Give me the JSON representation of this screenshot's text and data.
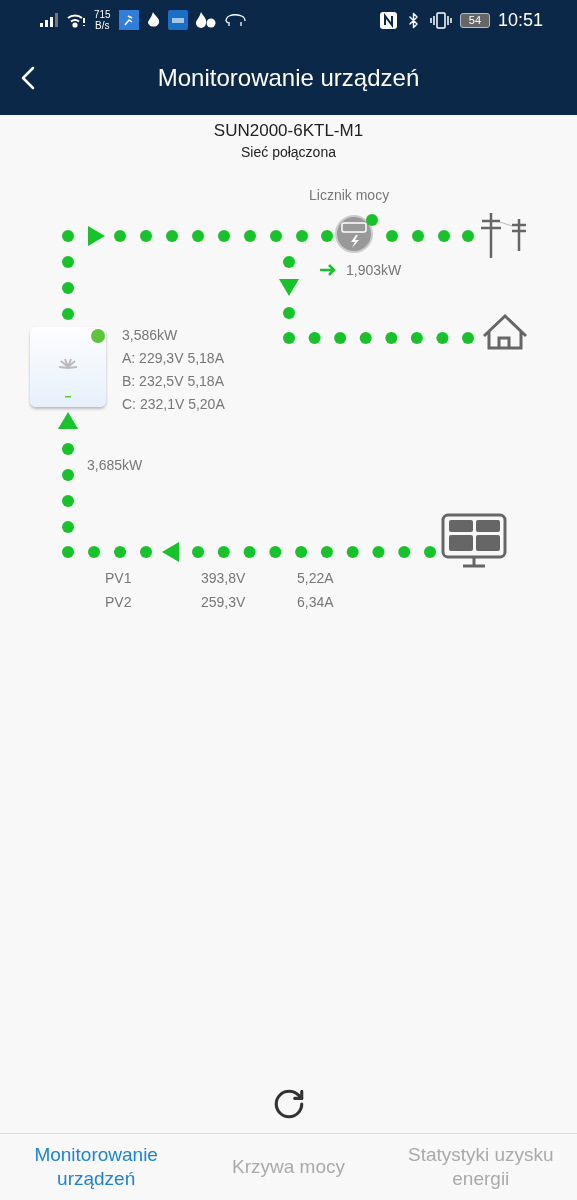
{
  "status_bar": {
    "network_speed": "715",
    "network_speed_unit": "B/s",
    "battery": "54",
    "time": "10:51"
  },
  "header": {
    "title": "Monitorowanie urządzeń"
  },
  "device": {
    "name": "SUN2000-6KTL-M1",
    "status": "Sieć połączona"
  },
  "meter": {
    "label": "Licznik mocy",
    "power": "1,903kW"
  },
  "inverter": {
    "power": "3,586kW",
    "phases": [
      "A: 229,3V 5,18A",
      "B: 232,5V 5,18A",
      "C: 232,1V 5,20A"
    ]
  },
  "pv": {
    "power": "3,685kW",
    "strings": [
      {
        "name": "PV1",
        "voltage": "393,8V",
        "current": "5,22A"
      },
      {
        "name": "PV2",
        "voltage": "259,3V",
        "current": "6,34A"
      }
    ]
  },
  "tabs": [
    {
      "label": "Monitorowanie urządzeń",
      "selected": true
    },
    {
      "label": "Krzywa mocy",
      "selected": false
    },
    {
      "label": "Statystyki uzysku energii",
      "selected": false
    }
  ]
}
